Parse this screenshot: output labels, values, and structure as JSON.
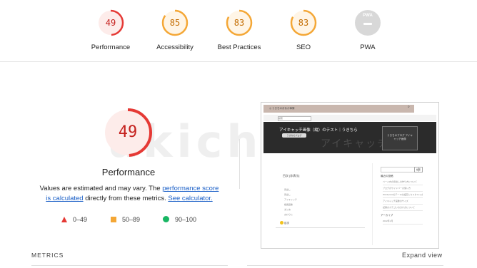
{
  "categories": [
    {
      "label": "Performance",
      "score": 49,
      "color": "#e53935",
      "bg": "#fdecea"
    },
    {
      "label": "Accessibility",
      "score": 85,
      "color": "#f4a736",
      "bg": "#fff5e6"
    },
    {
      "label": "Best Practices",
      "score": 83,
      "color": "#f4a736",
      "bg": "#fff5e6"
    },
    {
      "label": "SEO",
      "score": 83,
      "color": "#f4a736",
      "bg": "#fff5e6"
    },
    {
      "label": "PWA",
      "badge": "PWA"
    }
  ],
  "main": {
    "score": 49,
    "title": "Performance",
    "desc_prefix": "Values are estimated and may vary. The ",
    "desc_link1": "performance score is calculated",
    "desc_middle": " directly from these metrics. ",
    "desc_link2": "See calculator."
  },
  "legend": [
    {
      "range": "0–49",
      "color": "#e53935"
    },
    {
      "range": "50–89",
      "color": "#f4a736"
    },
    {
      "range": "90–100",
      "color": "#18b663"
    }
  ],
  "watermark": "ukichi",
  "screenshot": {
    "header_title": "◎ うきちのおなか事情",
    "search_icon": "search-icon",
    "search_placeholder": "検索",
    "banner_title": "アイキャッチ画像（縦）のテスト｜うきちら",
    "banner_button": "うきちのブログ",
    "banner_card": "うきちのブログ\nアイキャッチ画像",
    "banner_deco": "アイキャッチ",
    "toc_title": "目次  [非表示]",
    "toc_items": [
      "見出し",
      "見出し",
      "アイキャッチ",
      "縦長画像",
      "まとめ",
      "おわりに"
    ],
    "side_search_btn": "検索",
    "side_heading_recent": "最近の投稿",
    "side_recent_items": [
      "ページ内の見出しの作り方について",
      "ブログのサイドバーの使い方",
      "Wordpressのテーマの設定とカスタマイズ方法",
      "アイキャッチ画像のサイズ",
      "記事のカテゴリの分け方について"
    ],
    "side_heading_archive": "アーカイブ",
    "side_archive_item": "2022年1月",
    "footer_tag": "目次"
  },
  "footer": {
    "metrics_label": "METRICS",
    "expand_label": "Expand view"
  }
}
